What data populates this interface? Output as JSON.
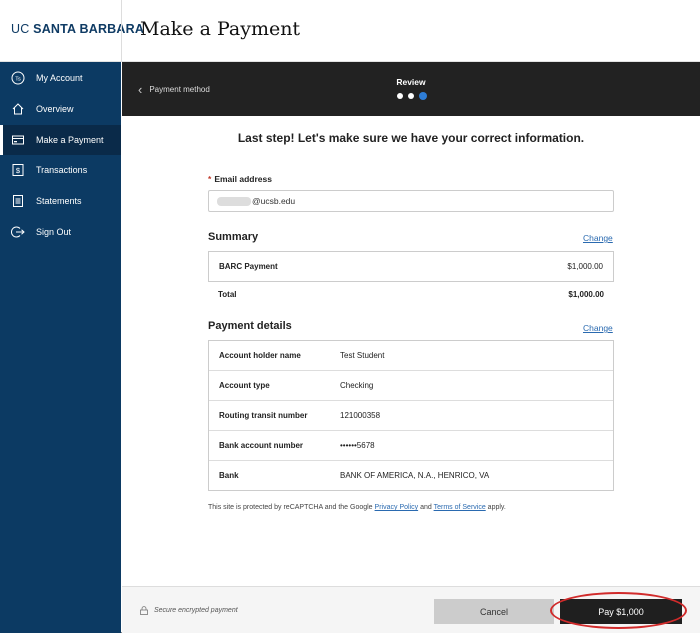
{
  "brand": {
    "prefix": "UC",
    "name": "SANTA BARBARA"
  },
  "page_title": "Make a Payment",
  "sidebar": {
    "items": [
      {
        "label": "My Account",
        "icon": "ts-avatar-icon",
        "active": false
      },
      {
        "label": "Overview",
        "icon": "home-icon",
        "active": false
      },
      {
        "label": "Make a Payment",
        "icon": "payment-icon",
        "active": true
      },
      {
        "label": "Transactions",
        "icon": "dollar-receipt-icon",
        "active": false
      },
      {
        "label": "Statements",
        "icon": "statement-icon",
        "active": false
      },
      {
        "label": "Sign Out",
        "icon": "sign-out-icon",
        "active": false
      }
    ],
    "avatar_initials": "Ts"
  },
  "stepper": {
    "back_label": "Payment method",
    "current_step": "Review",
    "steps_total": 3,
    "current_index": 3
  },
  "main": {
    "headline": "Last step! Let's make sure we have your correct information.",
    "email": {
      "label": "Email address",
      "required_marker": "*",
      "value_visible": "@ucsb.edu"
    },
    "summary": {
      "heading": "Summary",
      "change_label": "Change",
      "rows": [
        {
          "label": "BARC Payment",
          "amount": "$1,000.00"
        }
      ],
      "total_label": "Total",
      "total_amount": "$1,000.00"
    },
    "payment_details": {
      "heading": "Payment details",
      "change_label": "Change",
      "rows": [
        {
          "label": "Account holder name",
          "value": "Test Student"
        },
        {
          "label": "Account type",
          "value": "Checking"
        },
        {
          "label": "Routing transit number",
          "value": "121000358"
        },
        {
          "label": "Bank account number",
          "value": "••••••5678"
        },
        {
          "label": "Bank",
          "value": "BANK OF AMERICA, N.A., HENRICO, VA"
        }
      ]
    },
    "recaptcha": {
      "prefix": "This site is protected by reCAPTCHA and the Google",
      "privacy": "Privacy Policy",
      "and": "and",
      "terms": "Terms of Service",
      "suffix": "apply."
    }
  },
  "footer": {
    "secure_label": "Secure encrypted payment",
    "cancel_label": "Cancel",
    "pay_label": "Pay $1,000"
  },
  "colors": {
    "sidebar": "#0c3a63",
    "stepbar": "#222222",
    "accent_dot": "#2e7dd6",
    "link": "#2a6ab0",
    "highlight_ring": "#d12b2b"
  }
}
